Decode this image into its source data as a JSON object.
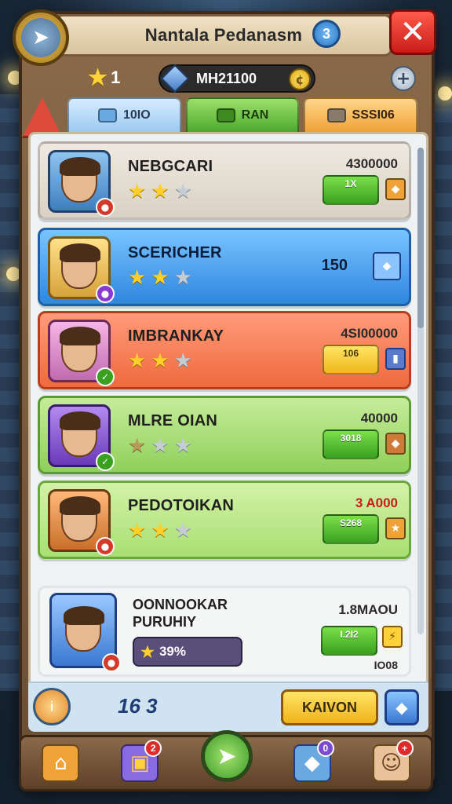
{
  "header": {
    "title": "Nantala Pedanasm",
    "badge": "3",
    "close": "✕"
  },
  "resources": {
    "stars": "1",
    "gems": "MH21100",
    "plus": "+"
  },
  "tabs": [
    {
      "label": "10IO"
    },
    {
      "label": "RAN"
    },
    {
      "label": "SSSI06"
    }
  ],
  "cards": [
    {
      "name": "NEBGCARI",
      "price": "4300000",
      "button": "1X"
    },
    {
      "name": "SCERICHER",
      "price": "150"
    },
    {
      "name": "IMBRANKAY",
      "price": "4SI00000",
      "button": "106"
    },
    {
      "name": "MLRE OIAN",
      "price": "40000",
      "button": "3018"
    },
    {
      "name": "PEDOTOIKAN",
      "price": "3 A000",
      "button": "S268"
    }
  ],
  "promo": {
    "name_line1": "OONNOOKAR",
    "name_line2": "PURUHIY",
    "price": "1.8MAOU",
    "button": "I.2I2",
    "subtext": "IO08",
    "bar": "39%"
  },
  "footer": {
    "count": "16 3",
    "button": "KAIVON"
  },
  "nav": {
    "inbox_badge": "2",
    "shop_badge": "0",
    "char_badge": "+"
  },
  "colors": {
    "accent_red": "#e22a2a",
    "accent_green": "#3aa020",
    "accent_yellow": "#f0b71a",
    "panel": "#eef2f4"
  },
  "icons": {
    "nav": "paper-plane-icon",
    "home": "home-icon",
    "inbox": "chest-icon",
    "center": "arrow-icon",
    "shop": "cube-icon",
    "profile": "avatar-icon"
  }
}
